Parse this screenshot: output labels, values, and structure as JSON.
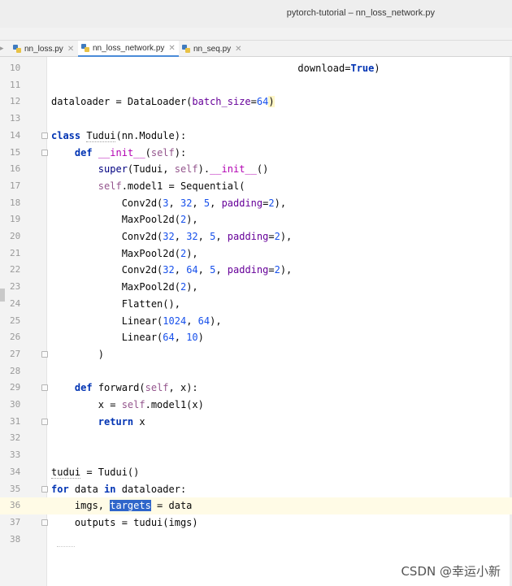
{
  "window": {
    "title": "pytorch-tutorial – nn_loss_network.py"
  },
  "tabs": [
    {
      "label": "nn_loss.py",
      "active": false
    },
    {
      "label": "nn_loss_network.py",
      "active": true
    },
    {
      "label": "nn_seq.py",
      "active": false
    }
  ],
  "editor": {
    "current_line": 36,
    "lines": [
      {
        "num": "10",
        "html": "                                          download=<span class=\"kw\">True</span>)"
      },
      {
        "num": "11",
        "html": ""
      },
      {
        "num": "12",
        "html": "dataloader = DataLoader(<span class=\"param\">batch_size</span>=<span class=\"num\">64</span><span class=\"warn\">)</span>"
      },
      {
        "num": "13",
        "html": ""
      },
      {
        "num": "14",
        "html": "<span class=\"kw\">class</span> <span class=\"dotted\">Tudui</span>(nn.Module):"
      },
      {
        "num": "15",
        "html": "    <span class=\"kw\">def</span> <span class=\"magic\">__init__</span>(<span class=\"selfc\">self</span>):"
      },
      {
        "num": "16",
        "html": "        <span class=\"kw\" style=\"font-weight:normal;color:#000080\">super</span>(Tudui, <span class=\"selfc\">self</span>).<span class=\"magic\">__init__</span>()"
      },
      {
        "num": "17",
        "html": "        <span class=\"selfc\">self</span>.model1 = Sequential("
      },
      {
        "num": "18",
        "html": "            Conv2d(<span class=\"num\">3</span>, <span class=\"num\">32</span>, <span class=\"num\">5</span>, <span class=\"param\">padding</span>=<span class=\"num\">2</span>),"
      },
      {
        "num": "19",
        "html": "            MaxPool2d(<span class=\"num\">2</span>),"
      },
      {
        "num": "20",
        "html": "            Conv2d(<span class=\"num\">32</span>, <span class=\"num\">32</span>, <span class=\"num\">5</span>, <span class=\"param\">padding</span>=<span class=\"num\">2</span>),"
      },
      {
        "num": "21",
        "html": "            MaxPool2d(<span class=\"num\">2</span>),"
      },
      {
        "num": "22",
        "html": "            Conv2d(<span class=\"num\">32</span>, <span class=\"num\">64</span>, <span class=\"num\">5</span>, <span class=\"param\">padding</span>=<span class=\"num\">2</span>),"
      },
      {
        "num": "23",
        "html": "            MaxPool2d(<span class=\"num\">2</span>),"
      },
      {
        "num": "24",
        "html": "            Flatten(),"
      },
      {
        "num": "25",
        "html": "            Linear(<span class=\"num\">1024</span>, <span class=\"num\">64</span>),"
      },
      {
        "num": "26",
        "html": "            Linear(<span class=\"num\">64</span>, <span class=\"num\">10</span>)"
      },
      {
        "num": "27",
        "html": "        )"
      },
      {
        "num": "28",
        "html": ""
      },
      {
        "num": "29",
        "html": "    <span class=\"kw\">def</span> forward(<span class=\"selfc\">self</span>, x):"
      },
      {
        "num": "30",
        "html": "        x = <span class=\"selfc\">self</span>.model1(x)"
      },
      {
        "num": "31",
        "html": "        <span class=\"kw\">return</span> x"
      },
      {
        "num": "32",
        "html": ""
      },
      {
        "num": "33",
        "html": ""
      },
      {
        "num": "34",
        "html": "<span class=\"dotted\">tudui</span> = Tudui()"
      },
      {
        "num": "35",
        "html": "<span class=\"kw\">for</span> data <span class=\"kw\">in</span> dataloader:"
      },
      {
        "num": "36",
        "html": "    imgs, <span class=\"sel\">targets</span> = data"
      },
      {
        "num": "37",
        "html": "    outputs = tudui(imgs)"
      },
      {
        "num": "38",
        "html": ""
      }
    ],
    "fold_lines": [
      "14",
      "15",
      "27",
      "29",
      "31",
      "35",
      "37"
    ]
  },
  "watermark": "CSDN @幸运小新"
}
